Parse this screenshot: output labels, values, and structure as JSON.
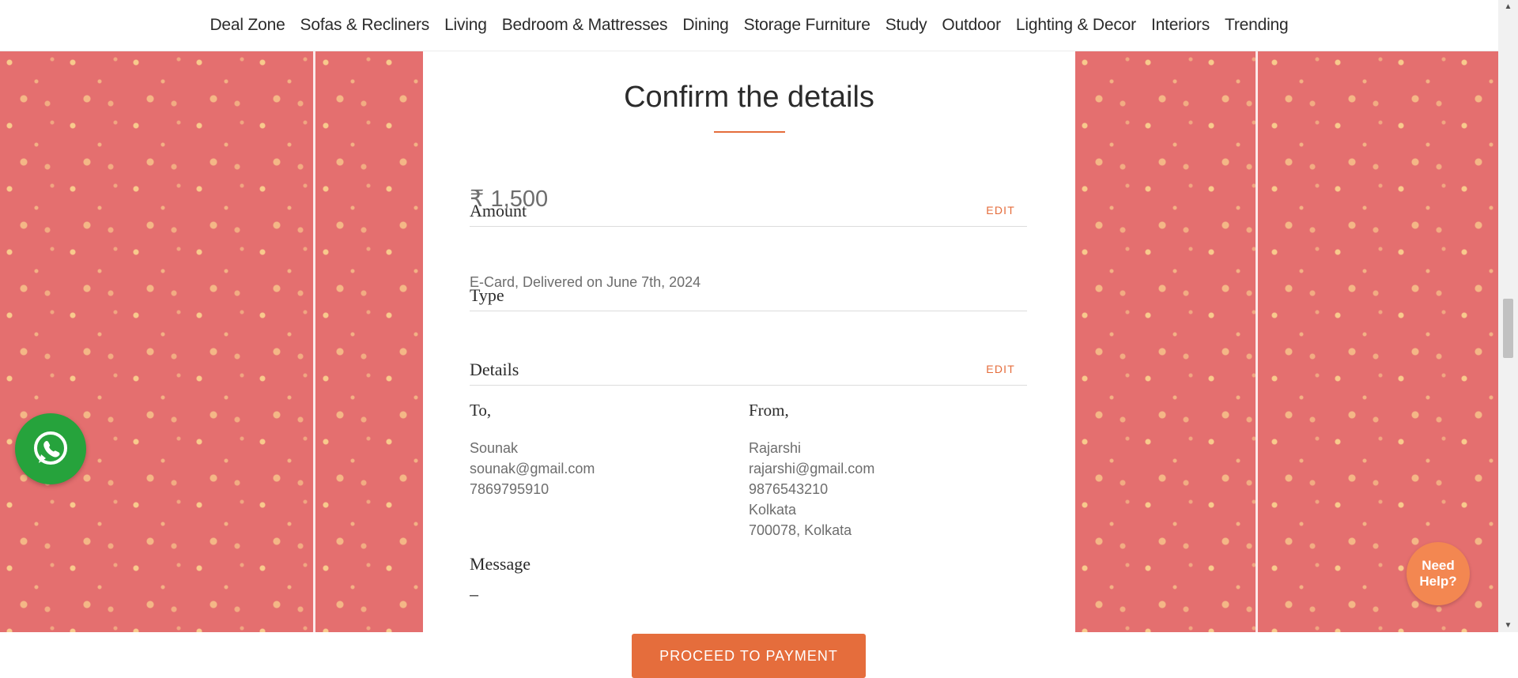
{
  "nav": {
    "items": [
      "Deal Zone",
      "Sofas & Recliners",
      "Living",
      "Bedroom & Mattresses",
      "Dining",
      "Storage Furniture",
      "Study",
      "Outdoor",
      "Lighting & Decor",
      "Interiors",
      "Trending"
    ]
  },
  "card": {
    "title": "Confirm the details",
    "amount": {
      "label": "Amount",
      "edit_label": "EDIT",
      "value": "₹ 1,500"
    },
    "type": {
      "label": "Type",
      "value": "E-Card, Delivered on June 7th, 2024"
    },
    "details": {
      "label": "Details",
      "edit_label": "EDIT",
      "to": {
        "heading": "To,",
        "lines": [
          "Sounak",
          "sounak@gmail.com",
          "7869795910"
        ]
      },
      "from": {
        "heading": "From,",
        "lines": [
          "Rajarshi",
          "rajarshi@gmail.com",
          "9876543210",
          "Kolkata",
          "700078, Kolkata"
        ]
      }
    },
    "message": {
      "label": "Message",
      "value": "–"
    },
    "proceed_label": "PROCEED TO PAYMENT"
  },
  "floating": {
    "whatsapp_icon": "whatsapp-icon",
    "help_label": "Need Help?"
  },
  "colors": {
    "accent": "#e56d3c",
    "pattern_bg": "#e46f6f",
    "whatsapp": "#26a33c",
    "help_bubble": "#f38751"
  }
}
